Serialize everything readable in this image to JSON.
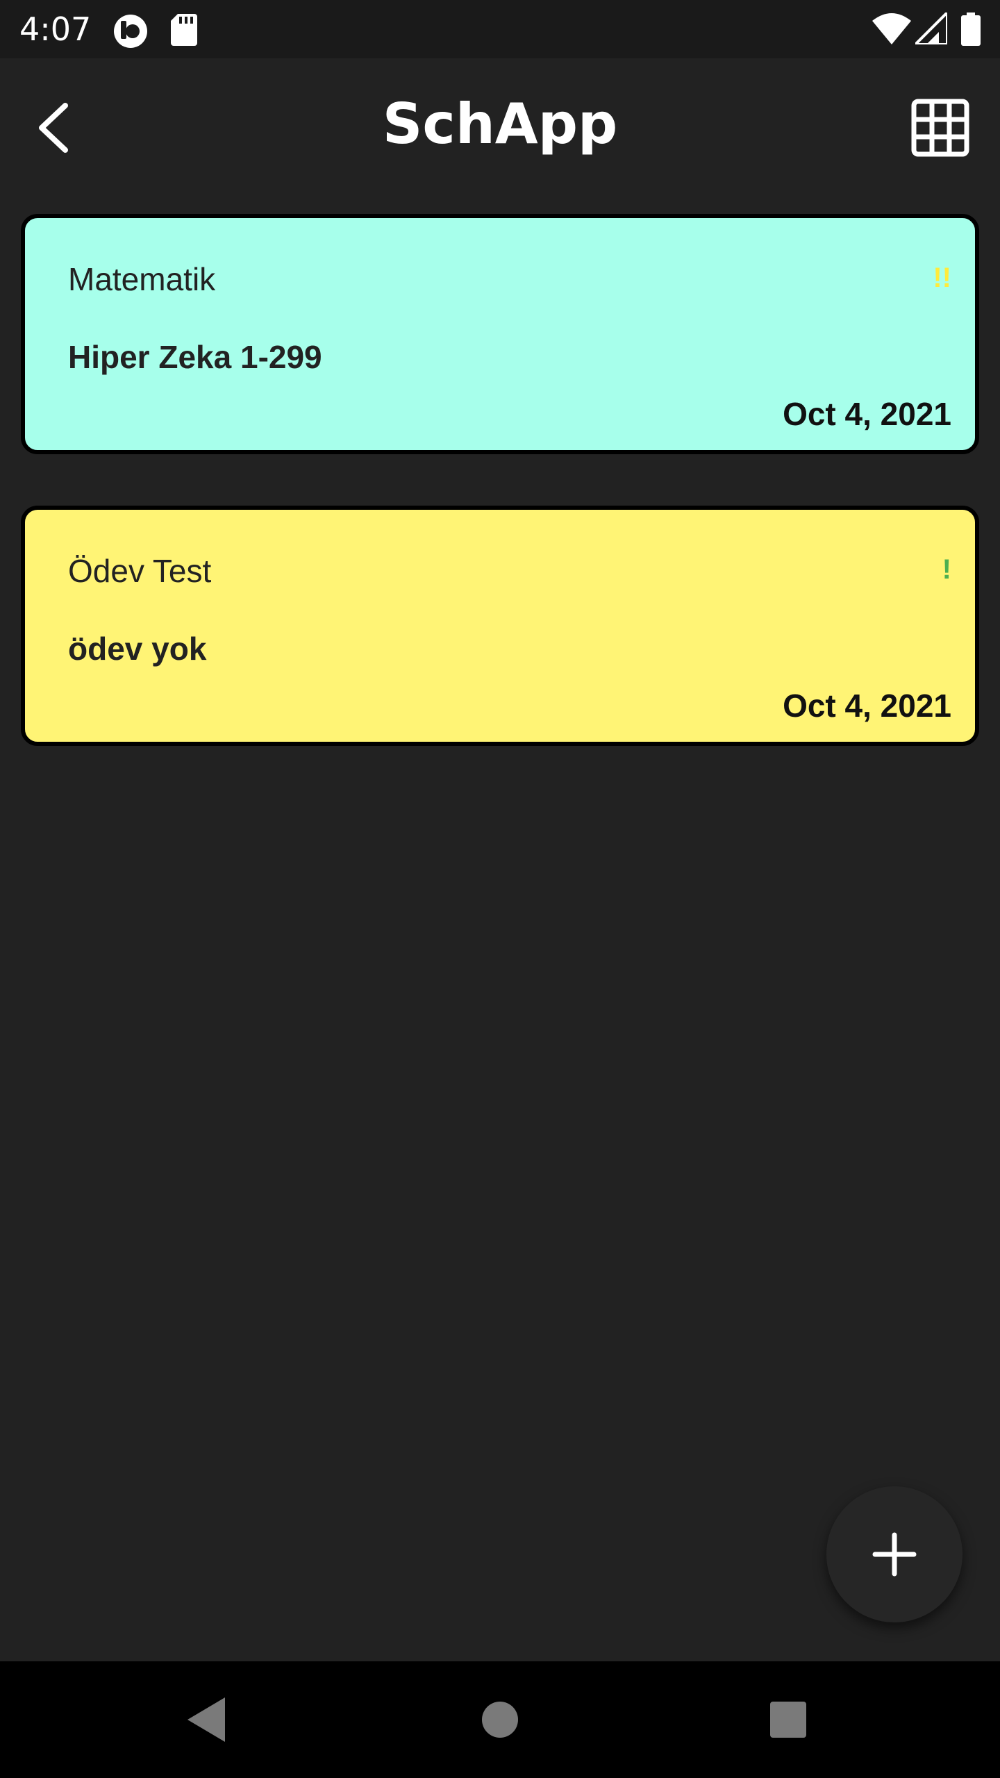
{
  "status_bar": {
    "time": "4:07",
    "left_icons": [
      "circle-app-icon",
      "sd-card-icon"
    ],
    "right_icons": [
      "wifi-icon",
      "cellular-signal-icon",
      "battery-icon"
    ]
  },
  "app_bar": {
    "title": "SchApp",
    "back_icon": "chevron-left-icon",
    "grid_icon": "grid-view-icon"
  },
  "tasks": [
    {
      "title": "Matematik",
      "description": "Hiper Zeka 1-299",
      "date": "Oct 4, 2021",
      "priority": "!!",
      "background_color": "#a7ffeb",
      "priority_color": "#ffeb3b"
    },
    {
      "title": "Ödev Test",
      "description": "ödev yok",
      "date": "Oct 4, 2021",
      "priority": "!",
      "background_color": "#fff475",
      "priority_color": "#4caf50"
    }
  ],
  "fab": {
    "icon": "plus-icon"
  },
  "nav_bar": {
    "buttons": [
      "back-triangle-icon",
      "home-circle-icon",
      "recents-square-icon"
    ]
  }
}
